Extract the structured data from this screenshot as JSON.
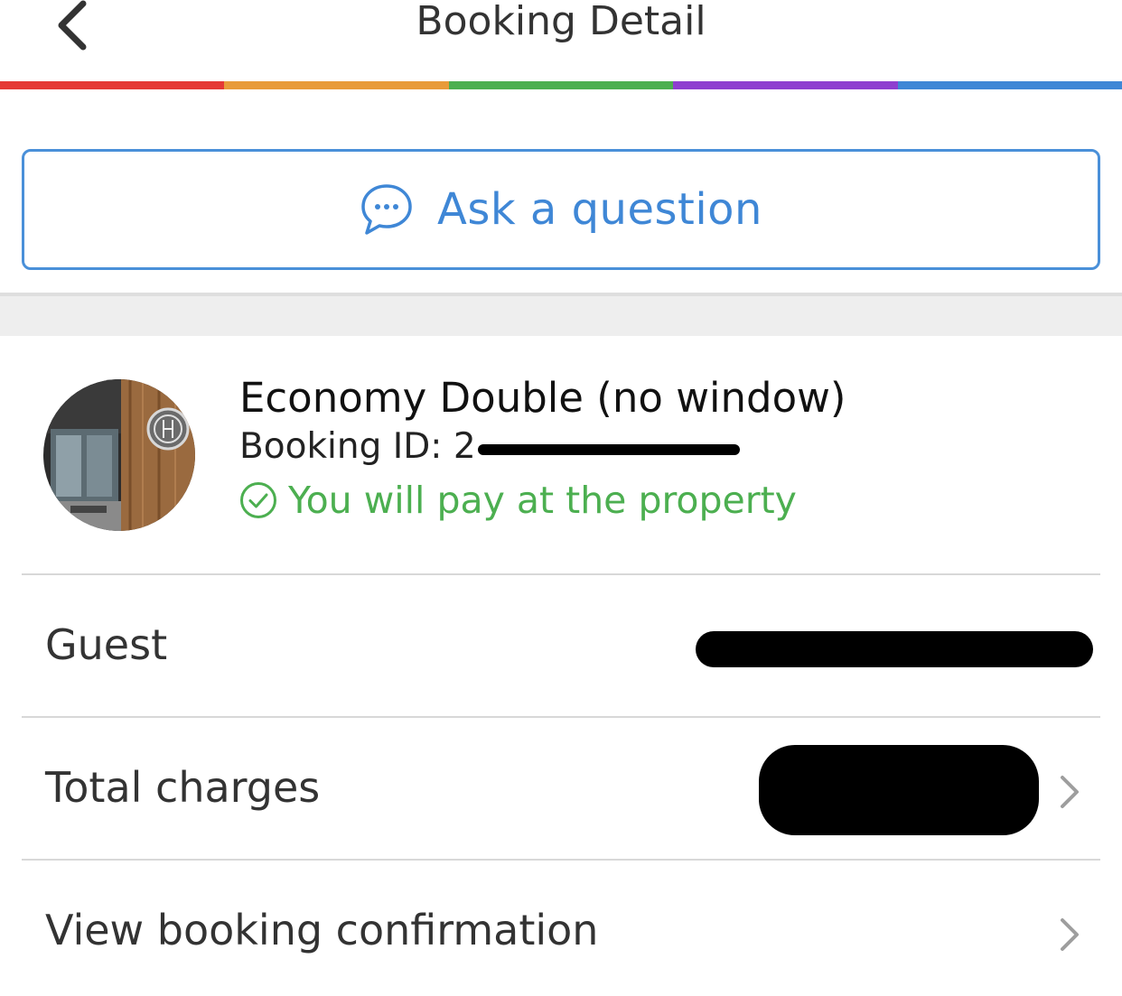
{
  "header": {
    "title": "Booking Detail",
    "back_icon": "chevron-left-icon"
  },
  "rainbow_colors": [
    "#e53935",
    "#e89b3a",
    "#4caf50",
    "#8e3fd0",
    "#3f87d6"
  ],
  "ask": {
    "label": "Ask a question",
    "icon": "chat-bubble-icon",
    "color": "#3f87d6"
  },
  "booking": {
    "room_name": "Economy Double (no window)",
    "booking_id_label": "Booking ID: 2",
    "payment_status": "You will pay at the property",
    "payment_icon": "check-circle-icon",
    "payment_color": "#4caf50"
  },
  "rows": [
    {
      "label": "Guest"
    },
    {
      "label": "Total charges"
    },
    {
      "label": "View booking confirmation"
    }
  ]
}
